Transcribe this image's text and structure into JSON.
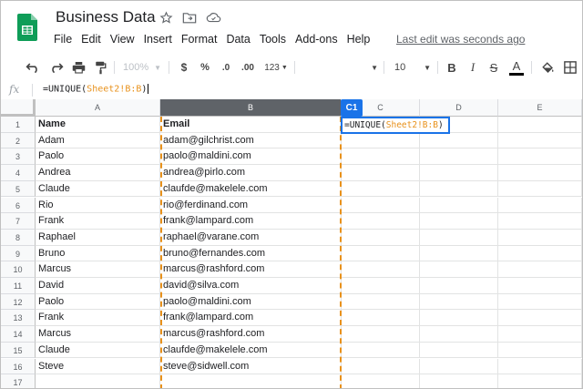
{
  "app": {
    "title": "Business Data",
    "last_edit": "Last edit was seconds ago",
    "menu": [
      "File",
      "Edit",
      "View",
      "Insert",
      "Format",
      "Data",
      "Tools",
      "Add-ons",
      "Help"
    ]
  },
  "toolbar": {
    "zoom": "100%",
    "currency": "$",
    "percent": "%",
    "dec_decrease": ".0",
    "dec_increase": ".00",
    "format_more": "123",
    "font_size": "10",
    "bold": "B",
    "italic": "I",
    "strike": "S",
    "text_color": "A"
  },
  "formula_bar": {
    "fx": "fx",
    "prefix": "=UNIQUE(",
    "ref": "Sheet2!B:B",
    "suffix": ")"
  },
  "active_cell": {
    "name": "C1",
    "prefix": "=UNIQUE(",
    "ref": "Sheet2!B:B",
    "suffix": ")"
  },
  "columns": [
    "A",
    "B",
    "C",
    "D",
    "E"
  ],
  "rows": [
    {
      "num": "1",
      "a": "Name",
      "b": "Email"
    },
    {
      "num": "2",
      "a": "Adam",
      "b": "adam@gilchrist.com"
    },
    {
      "num": "3",
      "a": "Paolo",
      "b": "paolo@maldini.com"
    },
    {
      "num": "4",
      "a": "Andrea",
      "b": "andrea@pirlo.com"
    },
    {
      "num": "5",
      "a": "Claude",
      "b": "claufde@makelele.com"
    },
    {
      "num": "6",
      "a": "Rio",
      "b": "rio@ferdinand.com"
    },
    {
      "num": "7",
      "a": "Frank",
      "b": "frank@lampard.com"
    },
    {
      "num": "8",
      "a": "Raphael",
      "b": "raphael@varane.com"
    },
    {
      "num": "9",
      "a": "Bruno",
      "b": "bruno@fernandes.com"
    },
    {
      "num": "10",
      "a": "Marcus",
      "b": "marcus@rashford.com"
    },
    {
      "num": "11",
      "a": "David",
      "b": "david@silva.com"
    },
    {
      "num": "12",
      "a": "Paolo",
      "b": "paolo@maldini.com"
    },
    {
      "num": "13",
      "a": "Frank",
      "b": "frank@lampard.com"
    },
    {
      "num": "14",
      "a": "Marcus",
      "b": "marcus@rashford.com"
    },
    {
      "num": "15",
      "a": "Claude",
      "b": "claufde@makelele.com"
    },
    {
      "num": "16",
      "a": "Steve",
      "b": "steve@sidwell.com"
    },
    {
      "num": "17",
      "a": "",
      "b": ""
    }
  ],
  "colors": {
    "accent": "#1a73e8",
    "range_highlight": "#e8911b",
    "sheets_green": "#0f9d58"
  }
}
